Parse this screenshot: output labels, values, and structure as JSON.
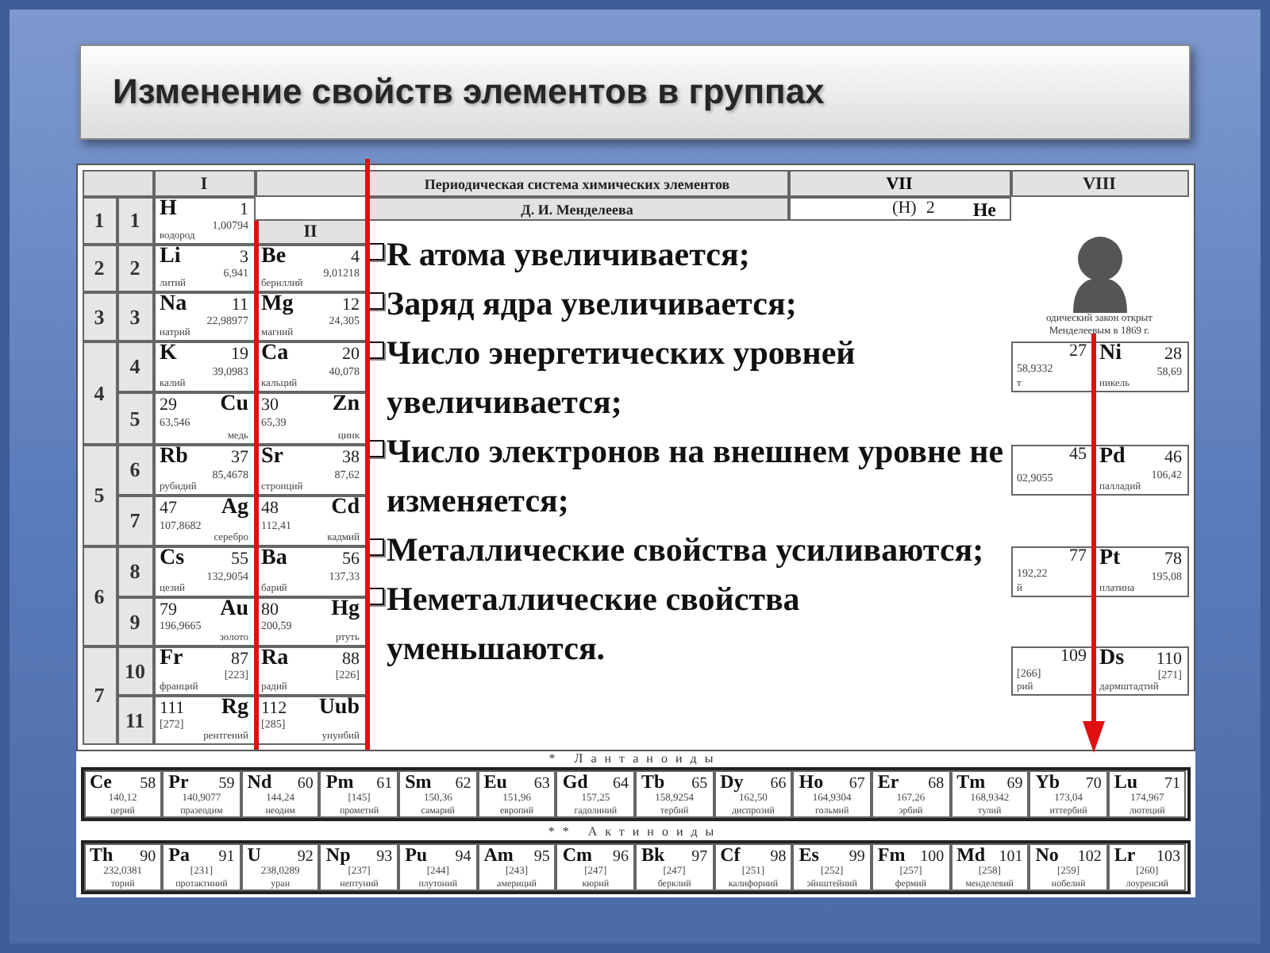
{
  "slide": {
    "title": "Изменение свойств элементов в группах"
  },
  "table": {
    "title": "Периодическая система химических элементов",
    "subtitle": "Д. И. Менделеева",
    "groups": [
      {
        "label": "I"
      },
      {
        "label": "II"
      },
      {
        "label": "VII"
      },
      {
        "label": "VIII"
      }
    ],
    "noble_cell": {
      "hydrogen": "(H)",
      "number": "2",
      "symbol": "He"
    },
    "portrait_caption": [
      "одический закон открыт",
      "Менделеевым в 1869 г."
    ],
    "periods": [
      {
        "label": "1",
        "rows": [
          {
            "label": "1",
            "cells": [
              {
                "kind": "main",
                "symbol": "H",
                "number": "1",
                "mass": "1,00794",
                "name": "водород"
              }
            ]
          }
        ]
      },
      {
        "label": "2",
        "rows": [
          {
            "label": "2",
            "cells": [
              {
                "kind": "main",
                "symbol": "Li",
                "number": "3",
                "mass": "6,941",
                "name": "литий"
              },
              {
                "kind": "main",
                "symbol": "Be",
                "number": "4",
                "mass": "9,01218",
                "name": "бериллий"
              }
            ]
          }
        ]
      },
      {
        "label": "3",
        "rows": [
          {
            "label": "3",
            "cells": [
              {
                "kind": "main",
                "symbol": "Na",
                "number": "11",
                "mass": "22,98977",
                "name": "натрий"
              },
              {
                "kind": "main",
                "symbol": "Mg",
                "number": "12",
                "mass": "24,305",
                "name": "магний"
              }
            ]
          }
        ]
      },
      {
        "label": "4",
        "rows": [
          {
            "label": "4",
            "cells": [
              {
                "kind": "main",
                "symbol": "K",
                "number": "19",
                "mass": "39,0983",
                "name": "калий"
              },
              {
                "kind": "main",
                "symbol": "Ca",
                "number": "20",
                "mass": "40,078",
                "name": "кальций"
              }
            ],
            "right_cells": [
              {
                "kind": "partial",
                "number": "27",
                "mass": "58,9332",
                "name": "т"
              },
              {
                "kind": "main",
                "symbol": "Ni",
                "number": "28",
                "mass": "58,69",
                "name": "никель"
              }
            ]
          },
          {
            "label": "5",
            "cells": [
              {
                "kind": "transition",
                "symbol": "Cu",
                "number": "29",
                "mass": "63,546",
                "name": "медь"
              },
              {
                "kind": "transition",
                "symbol": "Zn",
                "number": "30",
                "mass": "65,39",
                "name": "цинк"
              }
            ]
          }
        ]
      },
      {
        "label": "5",
        "rows": [
          {
            "label": "6",
            "cells": [
              {
                "kind": "main",
                "symbol": "Rb",
                "number": "37",
                "mass": "85,4678",
                "name": "рубидий"
              },
              {
                "kind": "main",
                "symbol": "Sr",
                "number": "38",
                "mass": "87,62",
                "name": "стронций"
              }
            ],
            "right_cells": [
              {
                "kind": "partial",
                "number": "45",
                "mass": "02,9055"
              },
              {
                "kind": "main",
                "symbol": "Pd",
                "number": "46",
                "mass": "106,42",
                "name": "палладий"
              }
            ]
          },
          {
            "label": "7",
            "cells": [
              {
                "kind": "transition",
                "symbol": "Ag",
                "number": "47",
                "mass": "107,8682",
                "name": "серебро"
              },
              {
                "kind": "transition",
                "symbol": "Cd",
                "number": "48",
                "mass": "112,41",
                "name": "кадмий"
              }
            ]
          }
        ]
      },
      {
        "label": "6",
        "rows": [
          {
            "label": "8",
            "cells": [
              {
                "kind": "main",
                "symbol": "Cs",
                "number": "55",
                "mass": "132,9054",
                "name": "цезий"
              },
              {
                "kind": "main",
                "symbol": "Ba",
                "number": "56",
                "mass": "137,33",
                "name": "барий"
              }
            ],
            "right_cells": [
              {
                "kind": "partial",
                "number": "77",
                "mass": "192,22",
                "name": "й"
              },
              {
                "kind": "main",
                "symbol": "Pt",
                "number": "78",
                "mass": "195,08",
                "name": "платина"
              }
            ]
          },
          {
            "label": "9",
            "cells": [
              {
                "kind": "transition",
                "symbol": "Au",
                "number": "79",
                "mass": "196,9665",
                "name": "золото"
              },
              {
                "kind": "transition",
                "symbol": "Hg",
                "number": "80",
                "mass": "200,59",
                "name": "ртуть"
              }
            ]
          }
        ]
      },
      {
        "label": "7",
        "rows": [
          {
            "label": "10",
            "cells": [
              {
                "kind": "main",
                "symbol": "Fr",
                "number": "87",
                "mass": "[223]",
                "name": "франций"
              },
              {
                "kind": "main",
                "symbol": "Ra",
                "number": "88",
                "mass": "[226]",
                "name": "радий"
              }
            ],
            "right_cells": [
              {
                "kind": "partial",
                "number": "109",
                "mass": "[266]",
                "name": "рий"
              },
              {
                "kind": "main",
                "symbol": "Ds",
                "number": "110",
                "mass": "[271]",
                "name": "дармштадтий"
              }
            ]
          },
          {
            "label": "11",
            "cells": [
              {
                "kind": "transition",
                "symbol": "Rg",
                "number": "111",
                "mass": "[272]",
                "name": "рентгений"
              },
              {
                "kind": "transition",
                "symbol": "Uub",
                "number": "112",
                "mass": "[285]",
                "name": "унунбий"
              }
            ]
          }
        ]
      }
    ],
    "statements": [
      "R атома увеличивается;",
      "Заряд ядра увеличивается;",
      "Число энергетических уровней увеличивается;",
      "Число электронов на внешнем уровне не изменяется;",
      "Металлические свойства усиливаются;",
      "Неметаллические свойства уменьшаются."
    ]
  },
  "series": [
    {
      "label": "* Лантаноиды",
      "elements": [
        {
          "symbol": "Ce",
          "number": "58",
          "mass": "140,12",
          "name": "церий"
        },
        {
          "symbol": "Pr",
          "number": "59",
          "mass": "140,9077",
          "name": "празеодим"
        },
        {
          "symbol": "Nd",
          "number": "60",
          "mass": "144,24",
          "name": "неодим"
        },
        {
          "symbol": "Pm",
          "number": "61",
          "mass": "[145]",
          "name": "прометий"
        },
        {
          "symbol": "Sm",
          "number": "62",
          "mass": "150,36",
          "name": "самарий"
        },
        {
          "symbol": "Eu",
          "number": "63",
          "mass": "151,96",
          "name": "европий"
        },
        {
          "symbol": "Gd",
          "number": "64",
          "mass": "157,25",
          "name": "гадолиний"
        },
        {
          "symbol": "Tb",
          "number": "65",
          "mass": "158,9254",
          "name": "тербий"
        },
        {
          "symbol": "Dy",
          "number": "66",
          "mass": "162,50",
          "name": "диспрозий"
        },
        {
          "symbol": "Ho",
          "number": "67",
          "mass": "164,9304",
          "name": "гольмий"
        },
        {
          "symbol": "Er",
          "number": "68",
          "mass": "167,26",
          "name": "эрбий"
        },
        {
          "symbol": "Tm",
          "number": "69",
          "mass": "168,9342",
          "name": "тулий"
        },
        {
          "symbol": "Yb",
          "number": "70",
          "mass": "173,04",
          "name": "иттербий"
        },
        {
          "symbol": "Lu",
          "number": "71",
          "mass": "174,967",
          "name": "лютеций"
        }
      ]
    },
    {
      "label": "** Актиноиды",
      "elements": [
        {
          "symbol": "Th",
          "number": "90",
          "mass": "232,0381",
          "name": "торий"
        },
        {
          "symbol": "Pa",
          "number": "91",
          "mass": "[231]",
          "name": "протактиний"
        },
        {
          "symbol": "U",
          "number": "92",
          "mass": "238,0289",
          "name": "уран"
        },
        {
          "symbol": "Np",
          "number": "93",
          "mass": "[237]",
          "name": "нептуний"
        },
        {
          "symbol": "Pu",
          "number": "94",
          "mass": "[244]",
          "name": "плутоний"
        },
        {
          "symbol": "Am",
          "number": "95",
          "mass": "[243]",
          "name": "америций"
        },
        {
          "symbol": "Cm",
          "number": "96",
          "mass": "[247]",
          "name": "кюрий"
        },
        {
          "symbol": "Bk",
          "number": "97",
          "mass": "[247]",
          "name": "берклий"
        },
        {
          "symbol": "Cf",
          "number": "98",
          "mass": "[251]",
          "name": "калифорний"
        },
        {
          "symbol": "Es",
          "number": "99",
          "mass": "[252]",
          "name": "эйнштейний"
        },
        {
          "symbol": "Fm",
          "number": "100",
          "mass": "[257]",
          "name": "фермий"
        },
        {
          "symbol": "Md",
          "number": "101",
          "mass": "[258]",
          "name": "менделевий"
        },
        {
          "symbol": "No",
          "number": "102",
          "mass": "[259]",
          "name": "нобелий"
        },
        {
          "symbol": "Lr",
          "number": "103",
          "mass": "[260]",
          "name": "лоуренсий"
        }
      ]
    }
  ]
}
